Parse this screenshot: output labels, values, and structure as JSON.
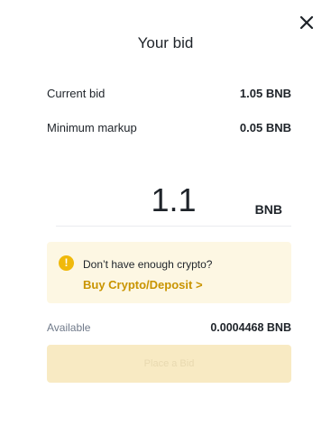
{
  "dialog": {
    "title": "Your bid",
    "close_icon": "close-icon"
  },
  "info": {
    "current_bid_label": "Current bid",
    "current_bid_value": "1.05 BNB",
    "min_markup_label": "Minimum markup",
    "min_markup_value": "0.05 BNB"
  },
  "bid_input": {
    "value": "1.1",
    "currency": "BNB"
  },
  "warning": {
    "icon": "warning-icon",
    "icon_glyph": "!",
    "message": "Don’t have enough crypto?",
    "link_label": "Buy Crypto/Deposit >"
  },
  "available": {
    "label": "Available",
    "value": "0.0004468 BNB"
  },
  "actions": {
    "place_bid_label": "Place a Bid",
    "place_bid_enabled": false
  },
  "colors": {
    "accent": "#F0B90B",
    "link": "#C99400",
    "warning_bg": "#FDF7E3",
    "button_disabled_bg": "#F8EAC3",
    "text_primary": "#1E2329",
    "text_secondary": "#707A8A"
  }
}
